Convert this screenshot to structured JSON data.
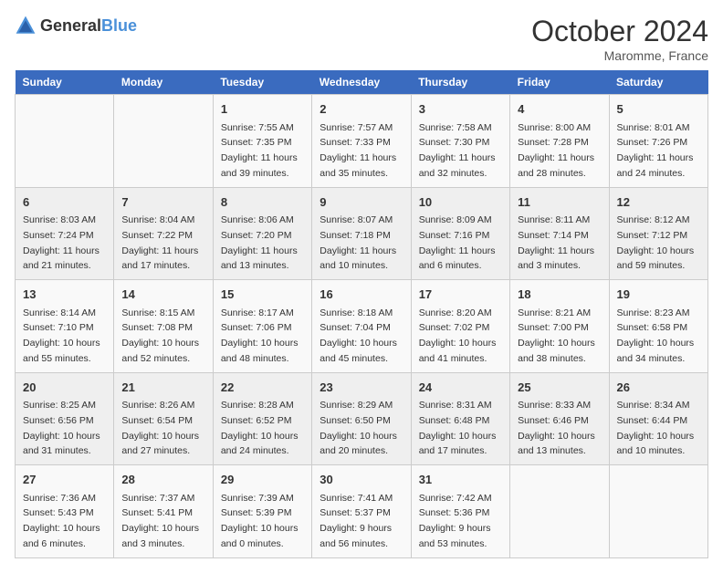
{
  "header": {
    "logo_general": "General",
    "logo_blue": "Blue",
    "month_title": "October 2024",
    "location": "Maromme, France"
  },
  "days_of_week": [
    "Sunday",
    "Monday",
    "Tuesday",
    "Wednesday",
    "Thursday",
    "Friday",
    "Saturday"
  ],
  "weeks": [
    [
      {
        "day": "",
        "sunrise": "",
        "sunset": "",
        "daylight": ""
      },
      {
        "day": "",
        "sunrise": "",
        "sunset": "",
        "daylight": ""
      },
      {
        "day": "1",
        "sunrise": "Sunrise: 7:55 AM",
        "sunset": "Sunset: 7:35 PM",
        "daylight": "Daylight: 11 hours and 39 minutes."
      },
      {
        "day": "2",
        "sunrise": "Sunrise: 7:57 AM",
        "sunset": "Sunset: 7:33 PM",
        "daylight": "Daylight: 11 hours and 35 minutes."
      },
      {
        "day": "3",
        "sunrise": "Sunrise: 7:58 AM",
        "sunset": "Sunset: 7:30 PM",
        "daylight": "Daylight: 11 hours and 32 minutes."
      },
      {
        "day": "4",
        "sunrise": "Sunrise: 8:00 AM",
        "sunset": "Sunset: 7:28 PM",
        "daylight": "Daylight: 11 hours and 28 minutes."
      },
      {
        "day": "5",
        "sunrise": "Sunrise: 8:01 AM",
        "sunset": "Sunset: 7:26 PM",
        "daylight": "Daylight: 11 hours and 24 minutes."
      }
    ],
    [
      {
        "day": "6",
        "sunrise": "Sunrise: 8:03 AM",
        "sunset": "Sunset: 7:24 PM",
        "daylight": "Daylight: 11 hours and 21 minutes."
      },
      {
        "day": "7",
        "sunrise": "Sunrise: 8:04 AM",
        "sunset": "Sunset: 7:22 PM",
        "daylight": "Daylight: 11 hours and 17 minutes."
      },
      {
        "day": "8",
        "sunrise": "Sunrise: 8:06 AM",
        "sunset": "Sunset: 7:20 PM",
        "daylight": "Daylight: 11 hours and 13 minutes."
      },
      {
        "day": "9",
        "sunrise": "Sunrise: 8:07 AM",
        "sunset": "Sunset: 7:18 PM",
        "daylight": "Daylight: 11 hours and 10 minutes."
      },
      {
        "day": "10",
        "sunrise": "Sunrise: 8:09 AM",
        "sunset": "Sunset: 7:16 PM",
        "daylight": "Daylight: 11 hours and 6 minutes."
      },
      {
        "day": "11",
        "sunrise": "Sunrise: 8:11 AM",
        "sunset": "Sunset: 7:14 PM",
        "daylight": "Daylight: 11 hours and 3 minutes."
      },
      {
        "day": "12",
        "sunrise": "Sunrise: 8:12 AM",
        "sunset": "Sunset: 7:12 PM",
        "daylight": "Daylight: 10 hours and 59 minutes."
      }
    ],
    [
      {
        "day": "13",
        "sunrise": "Sunrise: 8:14 AM",
        "sunset": "Sunset: 7:10 PM",
        "daylight": "Daylight: 10 hours and 55 minutes."
      },
      {
        "day": "14",
        "sunrise": "Sunrise: 8:15 AM",
        "sunset": "Sunset: 7:08 PM",
        "daylight": "Daylight: 10 hours and 52 minutes."
      },
      {
        "day": "15",
        "sunrise": "Sunrise: 8:17 AM",
        "sunset": "Sunset: 7:06 PM",
        "daylight": "Daylight: 10 hours and 48 minutes."
      },
      {
        "day": "16",
        "sunrise": "Sunrise: 8:18 AM",
        "sunset": "Sunset: 7:04 PM",
        "daylight": "Daylight: 10 hours and 45 minutes."
      },
      {
        "day": "17",
        "sunrise": "Sunrise: 8:20 AM",
        "sunset": "Sunset: 7:02 PM",
        "daylight": "Daylight: 10 hours and 41 minutes."
      },
      {
        "day": "18",
        "sunrise": "Sunrise: 8:21 AM",
        "sunset": "Sunset: 7:00 PM",
        "daylight": "Daylight: 10 hours and 38 minutes."
      },
      {
        "day": "19",
        "sunrise": "Sunrise: 8:23 AM",
        "sunset": "Sunset: 6:58 PM",
        "daylight": "Daylight: 10 hours and 34 minutes."
      }
    ],
    [
      {
        "day": "20",
        "sunrise": "Sunrise: 8:25 AM",
        "sunset": "Sunset: 6:56 PM",
        "daylight": "Daylight: 10 hours and 31 minutes."
      },
      {
        "day": "21",
        "sunrise": "Sunrise: 8:26 AM",
        "sunset": "Sunset: 6:54 PM",
        "daylight": "Daylight: 10 hours and 27 minutes."
      },
      {
        "day": "22",
        "sunrise": "Sunrise: 8:28 AM",
        "sunset": "Sunset: 6:52 PM",
        "daylight": "Daylight: 10 hours and 24 minutes."
      },
      {
        "day": "23",
        "sunrise": "Sunrise: 8:29 AM",
        "sunset": "Sunset: 6:50 PM",
        "daylight": "Daylight: 10 hours and 20 minutes."
      },
      {
        "day": "24",
        "sunrise": "Sunrise: 8:31 AM",
        "sunset": "Sunset: 6:48 PM",
        "daylight": "Daylight: 10 hours and 17 minutes."
      },
      {
        "day": "25",
        "sunrise": "Sunrise: 8:33 AM",
        "sunset": "Sunset: 6:46 PM",
        "daylight": "Daylight: 10 hours and 13 minutes."
      },
      {
        "day": "26",
        "sunrise": "Sunrise: 8:34 AM",
        "sunset": "Sunset: 6:44 PM",
        "daylight": "Daylight: 10 hours and 10 minutes."
      }
    ],
    [
      {
        "day": "27",
        "sunrise": "Sunrise: 7:36 AM",
        "sunset": "Sunset: 5:43 PM",
        "daylight": "Daylight: 10 hours and 6 minutes."
      },
      {
        "day": "28",
        "sunrise": "Sunrise: 7:37 AM",
        "sunset": "Sunset: 5:41 PM",
        "daylight": "Daylight: 10 hours and 3 minutes."
      },
      {
        "day": "29",
        "sunrise": "Sunrise: 7:39 AM",
        "sunset": "Sunset: 5:39 PM",
        "daylight": "Daylight: 10 hours and 0 minutes."
      },
      {
        "day": "30",
        "sunrise": "Sunrise: 7:41 AM",
        "sunset": "Sunset: 5:37 PM",
        "daylight": "Daylight: 9 hours and 56 minutes."
      },
      {
        "day": "31",
        "sunrise": "Sunrise: 7:42 AM",
        "sunset": "Sunset: 5:36 PM",
        "daylight": "Daylight: 9 hours and 53 minutes."
      },
      {
        "day": "",
        "sunrise": "",
        "sunset": "",
        "daylight": ""
      },
      {
        "day": "",
        "sunrise": "",
        "sunset": "",
        "daylight": ""
      }
    ]
  ]
}
